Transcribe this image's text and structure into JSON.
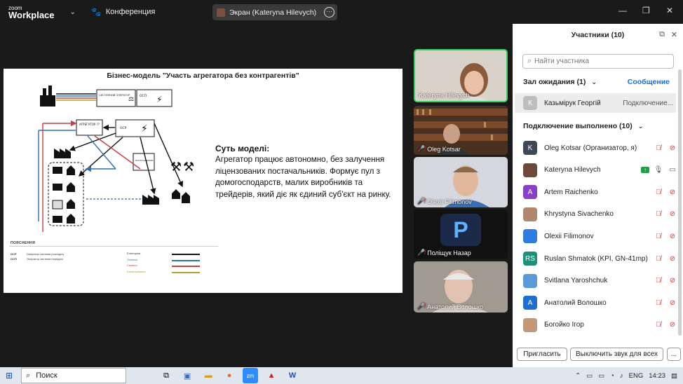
{
  "app": {
    "logo_line1": "zoom",
    "logo_line2": "Workplace",
    "conference_label": "Конференция",
    "screen_share_label": "Экран (Kateryna Hilevych)"
  },
  "slide": {
    "title": "Бізнес-модель \"Участь агрегатора без контрагентів\"",
    "diagram_labels": {
      "system_operator": "СИСТЕМНИЙ ОПЕРАТОР",
      "osp_top": "ОСП",
      "aggregator": "АГРЕГАТОР ??",
      "osr": "ОСР",
      "supplier": "ПОСТАЧАЛЬНИК"
    },
    "model_heading": "Суть моделі:",
    "model_text": "Агрегатор працює автономно, без залучення ліцензованих постачальників. Формує пул з домогосподарств, малих виробників та трейдерів, який діє як єдиний суб'єкт на ринку.",
    "legend_title": "ПОЯСНЕННЯ",
    "legend_abbr": [
      {
        "abbr": "ОСР",
        "text": "Оператор системи розподілу"
      },
      {
        "abbr": "ОСП",
        "text": "Оператор системи передачі"
      }
    ],
    "legend_lines": [
      {
        "label": "Електрика",
        "color": "#111111"
      },
      {
        "label": "Платежі",
        "color": "#2f6fb5"
      },
      {
        "label": "Сервіси",
        "color": "#c0404a"
      },
      {
        "label": "Балансування",
        "color": "#b5a030"
      }
    ]
  },
  "videos": [
    {
      "name": "Kateryna Hilevych",
      "muted": false
    },
    {
      "name": "Oleg Kotsar",
      "muted": true
    },
    {
      "name": "Olexii Filimonov",
      "muted": true
    },
    {
      "name": "Поліщук Назар",
      "muted": true
    },
    {
      "name": "Анатолий Волошко",
      "muted": true
    }
  ],
  "participants_panel": {
    "title": "Участники (10)",
    "search_placeholder": "Найти участника",
    "waiting_header": "Зал ожидания (1)",
    "admit_label": "Сообщение",
    "waiting": {
      "initial": "К",
      "name": "Казьмірук Георгій",
      "status": "Подключение..."
    },
    "connected_header": "Подключение выполнено (10)",
    "people": [
      {
        "initial": "K",
        "name": "Oleg Kotsar (Организатор, я)",
        "color": "#3d4a55",
        "muted": true
      },
      {
        "initial": "",
        "name": "Kateryna Hilevych",
        "color": "#6b4a3a",
        "muted": false,
        "sharing": true
      },
      {
        "initial": "A",
        "name": "Artem Raichenko",
        "color": "#8a3fc9",
        "muted": true
      },
      {
        "initial": "",
        "name": "Khrystyna Sivachenko",
        "color": "#b08870",
        "muted": true
      },
      {
        "initial": "",
        "name": "Olexii Filimonov",
        "color": "#2f7de0",
        "muted": true
      },
      {
        "initial": "RS",
        "name": "Ruslan Shmatok (KPI, GN-41mp)",
        "color": "#1d8f7a",
        "muted": true
      },
      {
        "initial": "",
        "name": "Svitlana Yaroshchuk",
        "color": "#5a9ad8",
        "muted": true
      },
      {
        "initial": "A",
        "name": "Анатолий Волошко",
        "color": "#1f6fd1",
        "muted": true
      },
      {
        "initial": "",
        "name": "Богойко Ігор",
        "color": "#c29878",
        "muted": true
      }
    ],
    "invite_button": "Пригласить",
    "mute_all_button": "Выключить звук для всех",
    "more_button": "..."
  },
  "taskbar": {
    "search_label": "Поиск",
    "lang": "ENG",
    "time": "14:23"
  }
}
